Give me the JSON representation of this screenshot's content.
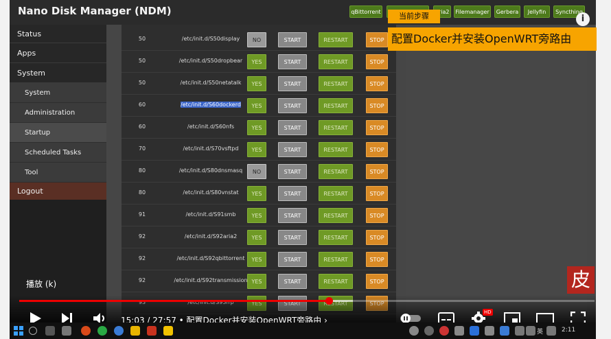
{
  "app": {
    "title": "Nano Disk Manager (NDM)"
  },
  "topnav": {
    "items": [
      "qBittorrent",
      "",
      "Aria2",
      "Filemanager",
      "Gerbera",
      "Jellyfin",
      "Syncthing"
    ]
  },
  "sidebar": {
    "items": [
      {
        "label": "Status"
      },
      {
        "label": "Apps"
      },
      {
        "label": "System"
      },
      {
        "label": "System"
      },
      {
        "label": "Administration"
      },
      {
        "label": "Startup"
      },
      {
        "label": "Scheduled Tasks"
      },
      {
        "label": "Tool"
      },
      {
        "label": "Logout"
      }
    ]
  },
  "startup": {
    "buttons": {
      "start": "START",
      "restart": "RESTART",
      "stop": "STOP"
    },
    "rows": [
      {
        "priority": "50",
        "script": "/etc/init.d/S50display",
        "enabled": "NO"
      },
      {
        "priority": "50",
        "script": "/etc/init.d/S50dropbear",
        "enabled": "YES"
      },
      {
        "priority": "50",
        "script": "/etc/init.d/S50netatalk",
        "enabled": "YES"
      },
      {
        "priority": "60",
        "script": "/etc/init.d/S60dockerd",
        "enabled": "YES"
      },
      {
        "priority": "60",
        "script": "/etc/init.d/S60nfs",
        "enabled": "YES"
      },
      {
        "priority": "70",
        "script": "/etc/init.d/S70vsftpd",
        "enabled": "YES"
      },
      {
        "priority": "80",
        "script": "/etc/init.d/S80dnsmasq",
        "enabled": "NO"
      },
      {
        "priority": "80",
        "script": "/etc/init.d/S80vnstat",
        "enabled": "YES"
      },
      {
        "priority": "91",
        "script": "/etc/init.d/S91smb",
        "enabled": "YES"
      },
      {
        "priority": "92",
        "script": "/etc/init.d/S92aria2",
        "enabled": "YES"
      },
      {
        "priority": "92",
        "script": "/etc/init.d/S92qbittorrent",
        "enabled": "YES"
      },
      {
        "priority": "92",
        "script": "/etc/init.d/S92transmission",
        "enabled": "YES"
      },
      {
        "priority": "93",
        "script": "/etc/init.d/S93frp",
        "enabled": "YES"
      }
    ]
  },
  "overlay": {
    "step_label": "当前步骤",
    "step_title": "配置Docker并安装OpenWRT旁路由",
    "info": "i",
    "logo_char": "皮",
    "pause_tooltip": "播放 (k)"
  },
  "player": {
    "time": "15:03 / 27:57 • 配置Docker并安装OpenWRT旁路由 ›",
    "played_fraction": 0.538,
    "buffered_fraction": 0.58,
    "hd_badge": "HD"
  },
  "taskbar": {
    "clock": "2:11",
    "ime": "英"
  },
  "colors": {
    "accent_green": "#6f9a25",
    "stop_orange": "#d98a25",
    "overlay_orange": "#f7a400",
    "progress_red": "#ee0000"
  }
}
